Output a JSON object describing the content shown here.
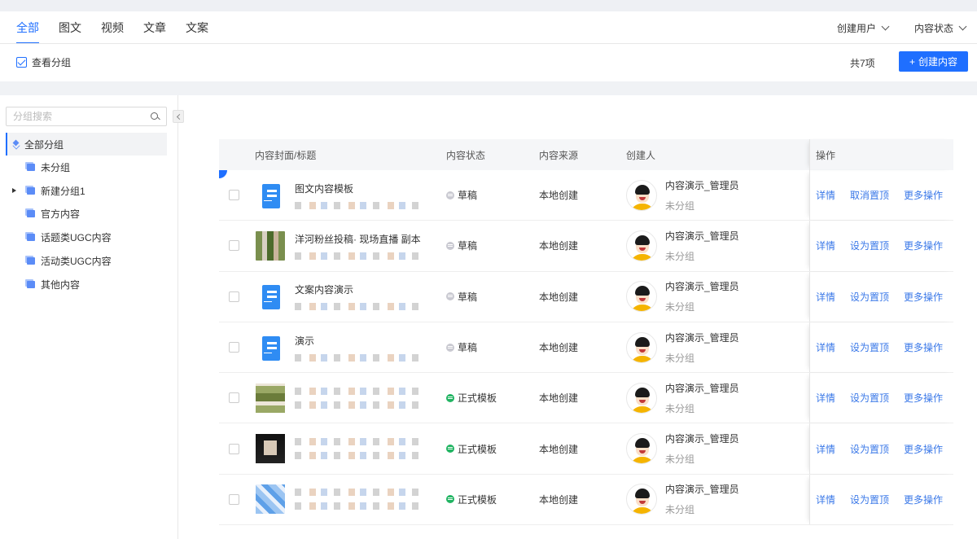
{
  "tabs": [
    {
      "label": "全部",
      "active": true
    },
    {
      "label": "图文",
      "active": false
    },
    {
      "label": "视频",
      "active": false
    },
    {
      "label": "文章",
      "active": false
    },
    {
      "label": "文案",
      "active": false
    }
  ],
  "filters": {
    "creator": "创建用户",
    "status": "内容状态"
  },
  "toolbar": {
    "view_group": "查看分组",
    "total": "共7项",
    "create_button": "创建内容",
    "create_plus": "+"
  },
  "sidebar": {
    "search_placeholder": "分组搜索",
    "root": "全部分组",
    "items": [
      "未分组",
      "新建分组1",
      "官方内容",
      "话题类UGC内容",
      "活动类UGC内容",
      "其他内容"
    ]
  },
  "table": {
    "headers": {
      "cover": "内容封面/标题",
      "status": "内容状态",
      "source": "内容来源",
      "creator": "创建人",
      "ops": "操作"
    },
    "rows": [
      {
        "title": "图文内容模板",
        "status": "草稿",
        "source": "本地创建",
        "creator": "内容演示_管理员",
        "group": "未分组",
        "op1": "详情",
        "op2": "取消置顶",
        "op3": "更多操作"
      },
      {
        "title": "洋河粉丝投稿· 现场直播 副本",
        "status": "草稿",
        "source": "本地创建",
        "creator": "内容演示_管理员",
        "group": "未分组",
        "op1": "详情",
        "op2": "设为置顶",
        "op3": "更多操作"
      },
      {
        "title": "文案内容演示",
        "status": "草稿",
        "source": "本地创建",
        "creator": "内容演示_管理员",
        "group": "未分组",
        "op1": "详情",
        "op2": "设为置顶",
        "op3": "更多操作"
      },
      {
        "title": "演示",
        "status": "草稿",
        "source": "本地创建",
        "creator": "内容演示_管理员",
        "group": "未分组",
        "op1": "详情",
        "op2": "设为置顶",
        "op3": "更多操作"
      },
      {
        "title": "",
        "status": "正式模板",
        "source": "本地创建",
        "creator": "内容演示_管理员",
        "group": "未分组",
        "op1": "详情",
        "op2": "设为置顶",
        "op3": "更多操作"
      },
      {
        "title": "",
        "status": "正式模板",
        "source": "本地创建",
        "creator": "内容演示_管理员",
        "group": "未分组",
        "op1": "详情",
        "op2": "设为置顶",
        "op3": "更多操作"
      },
      {
        "title": "",
        "status": "正式模板",
        "source": "本地创建",
        "creator": "内容演示_管理员",
        "group": "未分组",
        "op1": "详情",
        "op2": "设为置顶",
        "op3": "更多操作"
      }
    ]
  },
  "colors": {
    "accent": "#1f6fff",
    "link": "#3a78e8",
    "draft": "#c9c9d1",
    "live": "#21b462"
  },
  "icons": [
    "checkbox-icon",
    "chevron-down-icon",
    "search-icon",
    "layers-icon",
    "folder-icon",
    "caret-right-icon",
    "doc-icon",
    "avatar-icon",
    "status-dot-icon"
  ]
}
